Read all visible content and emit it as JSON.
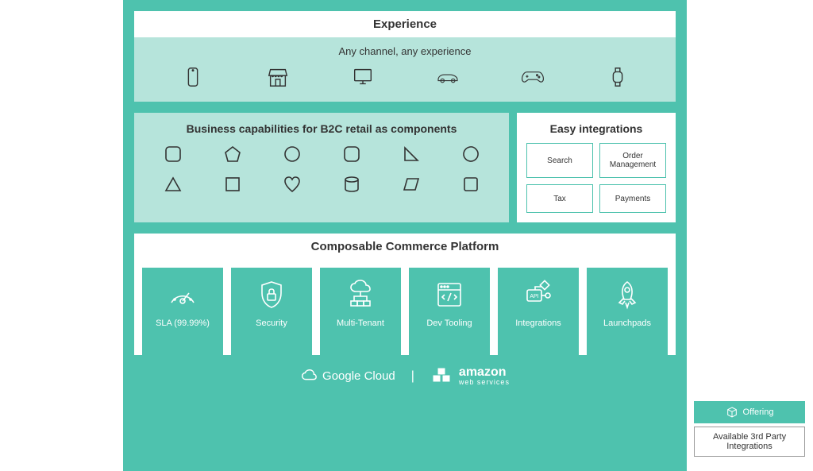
{
  "experience": {
    "title": "Experience",
    "subtitle": "Any channel, any experience",
    "channels": [
      "mobile",
      "store",
      "desktop",
      "car",
      "gaming",
      "watch"
    ]
  },
  "business": {
    "title": "Business capabilities for B2C retail as components"
  },
  "integrations": {
    "title": "Easy integrations",
    "items": [
      "Search",
      "Order Management",
      "Tax",
      "Payments"
    ]
  },
  "platform": {
    "title": "Composable Commerce Platform",
    "cards": [
      {
        "label": "SLA (99.99%)",
        "icon": "sla"
      },
      {
        "label": "Security",
        "icon": "security"
      },
      {
        "label": "Multi-Tenant",
        "icon": "multitenant"
      },
      {
        "label": "Dev Tooling",
        "icon": "devtooling"
      },
      {
        "label": "Integrations",
        "icon": "api"
      },
      {
        "label": "Launchpads",
        "icon": "launchpads"
      }
    ]
  },
  "footer": {
    "google": "Google Cloud",
    "aws_line1": "amazon",
    "aws_line2": "web services"
  },
  "legend": {
    "offering": "Offering",
    "third_party": "Available 3rd Party Integrations"
  }
}
